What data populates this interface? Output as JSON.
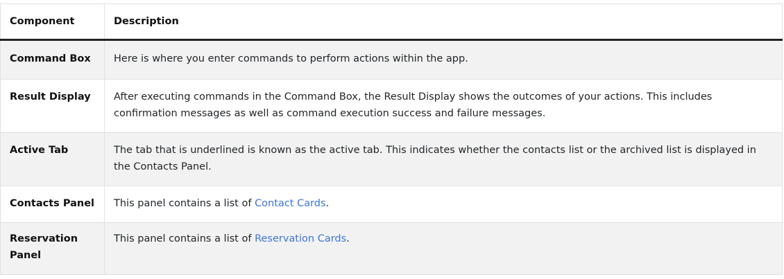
{
  "table": {
    "headers": [
      "Component",
      "Description"
    ],
    "rows": [
      {
        "component": "Command Box",
        "description": "Here is where you enter commands to perform actions within the app."
      },
      {
        "component": "Result Display",
        "description": "After executing commands in the Command Box, the Result Display shows the outcomes of your actions. This includes confirmation messages as well as command execution success and failure messages."
      },
      {
        "component": "Active Tab",
        "description": "The tab that is underlined is known as the active tab. This indicates whether the contacts list or the archived list is displayed in the Contacts Panel."
      },
      {
        "component": "Contacts Panel",
        "description_prefix": "This panel contains a list of ",
        "link_text": "Contact Cards",
        "description_suffix": "."
      },
      {
        "component": "Reservation Panel",
        "description_prefix": "This panel contains a list of ",
        "link_text": "Reservation Cards",
        "description_suffix": "."
      }
    ]
  },
  "colors": {
    "link": "#3c76d6",
    "stripe": "#f2f2f2",
    "border": "#dee2e6",
    "header_rule": "#222222"
  }
}
